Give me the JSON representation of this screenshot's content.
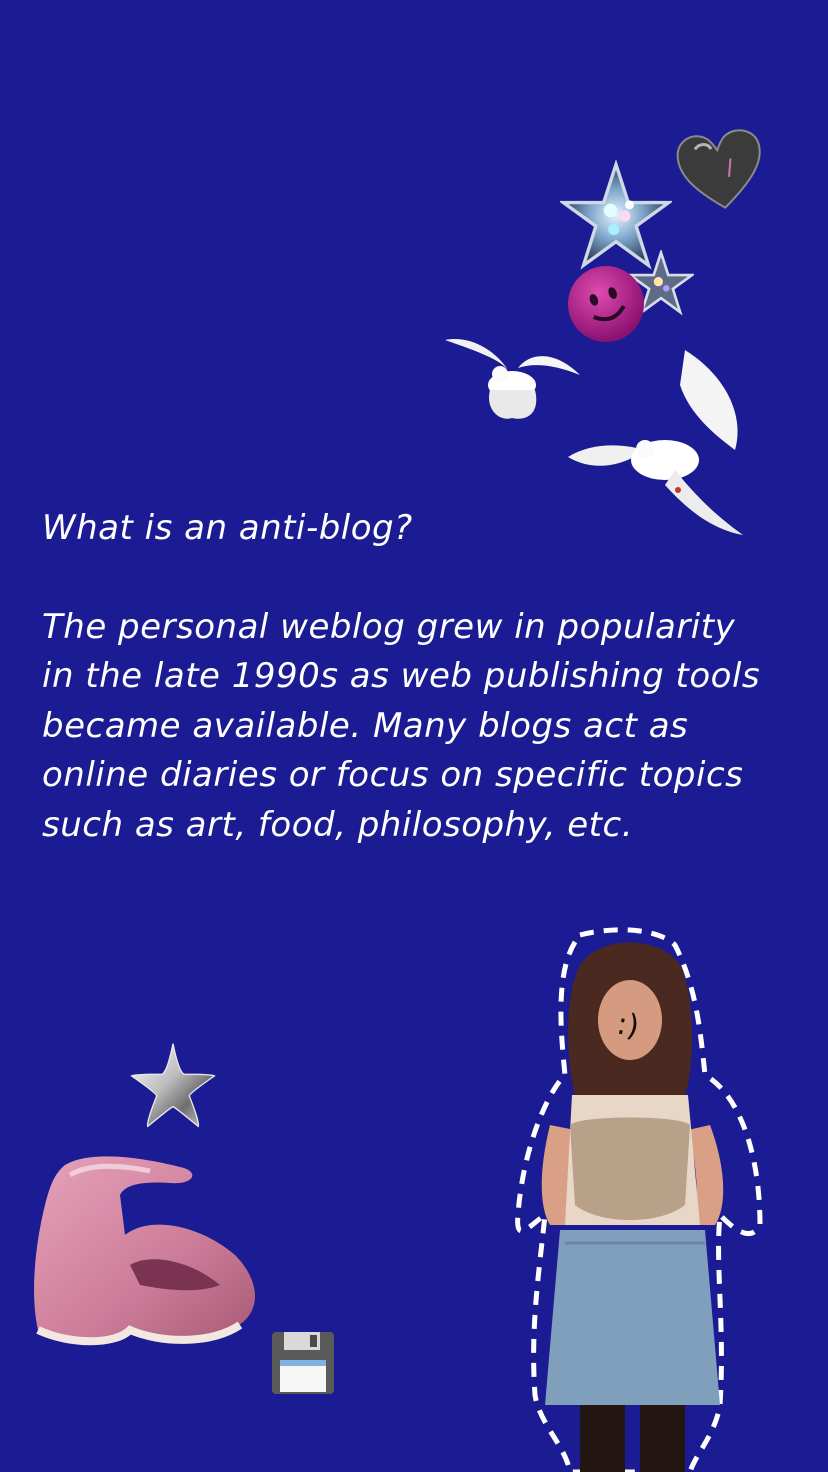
{
  "post": {
    "heading": "What is an anti-blog?",
    "body": "The personal weblog grew in popularity in the late 1990s as web publishing tools became available. Many blogs act as online diaries or focus on specific topics such as art, food, philosophy, etc."
  },
  "colors": {
    "background": "#1b1b93",
    "text": "#ffffff"
  },
  "stickers": [
    "dark-heart-sticker",
    "glitter-star-sticker",
    "smiley-face-sticker",
    "small-glitter-star-sticker",
    "dove-sticker",
    "dove-sticker",
    "chrome-star-sticker",
    "pink-platform-shoe-sticker",
    "floppy-disk-icon",
    "person-cutout-sticker"
  ]
}
